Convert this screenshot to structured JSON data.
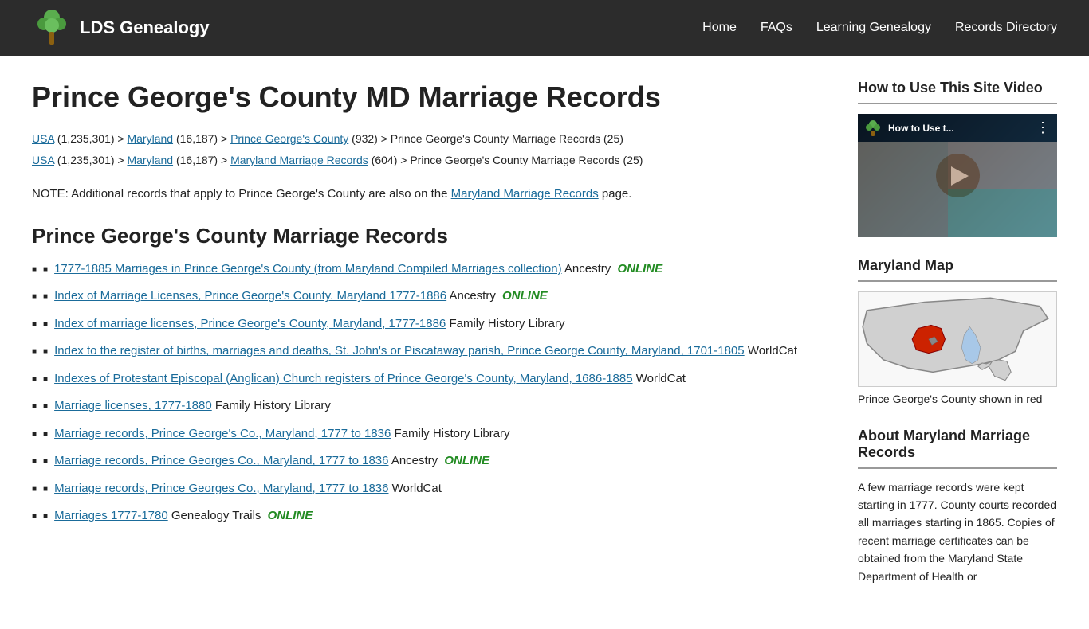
{
  "header": {
    "logo_text": "LDS Genealogy",
    "nav_items": [
      {
        "label": "Home",
        "href": "#"
      },
      {
        "label": "FAQs",
        "href": "#"
      },
      {
        "label": "Learning Genealogy",
        "href": "#"
      },
      {
        "label": "Records Directory",
        "href": "#"
      }
    ]
  },
  "main": {
    "page_title": "Prince George's County MD Marriage Records",
    "breadcrumbs": [
      {
        "line": "USA (1,235,301) > Maryland (16,187) > Prince George's County (932) > Prince George's County Marriage Records (25)"
      },
      {
        "line": "USA (1,235,301) > Maryland (16,187) > Maryland Marriage Records (604) > Prince George's County Marriage Records (25)"
      }
    ],
    "note": "NOTE: Additional records that apply to Prince George's County are also on the Maryland Marriage Records page.",
    "section_title": "Prince George's County Marriage Records",
    "records": [
      {
        "link_text": "1777-1885 Marriages in Prince George's County (from Maryland Compiled Marriages collection)",
        "suffix": "Ancestry",
        "online": true
      },
      {
        "link_text": "Index of Marriage Licenses, Prince George's County, Maryland 1777-1886",
        "suffix": "Ancestry",
        "online": true
      },
      {
        "link_text": "Index of marriage licenses, Prince George's County, Maryland, 1777-1886",
        "suffix": "Family History Library",
        "online": false
      },
      {
        "link_text": "Index to the register of births, marriages and deaths, St. John's or Piscataway parish, Prince George County, Maryland, 1701-1805",
        "suffix": "WorldCat",
        "online": false
      },
      {
        "link_text": "Indexes of Protestant Episcopal (Anglican) Church registers of Prince George's County, Maryland, 1686-1885",
        "suffix": "WorldCat",
        "online": false
      },
      {
        "link_text": "Marriage licenses, 1777-1880",
        "suffix": "Family History Library",
        "online": false
      },
      {
        "link_text": "Marriage records, Prince George's Co., Maryland, 1777 to 1836",
        "suffix": "Family History Library",
        "online": false
      },
      {
        "link_text": "Marriage records, Prince Georges Co., Maryland, 1777 to 1836",
        "suffix": "Ancestry",
        "online": true
      },
      {
        "link_text": "Marriage records, Prince Georges Co., Maryland, 1777 to 1836",
        "suffix": "WorldCat",
        "online": false
      },
      {
        "link_text": "Marriages 1777-1780",
        "suffix": "Genealogy Trails",
        "online": true
      }
    ]
  },
  "sidebar": {
    "video_section": {
      "title": "How to Use This Site Video",
      "video_title": "How to Use t..."
    },
    "map_section": {
      "title": "Maryland Map",
      "caption": "Prince George's County shown in red"
    },
    "about_section": {
      "title": "About Maryland Marriage Records",
      "text": "A few marriage records were kept starting in 1777. County courts recorded all marriages starting in 1865. Copies of recent marriage certificates can be obtained from the Maryland State Department of Health or"
    }
  },
  "online_label": "ONLINE"
}
